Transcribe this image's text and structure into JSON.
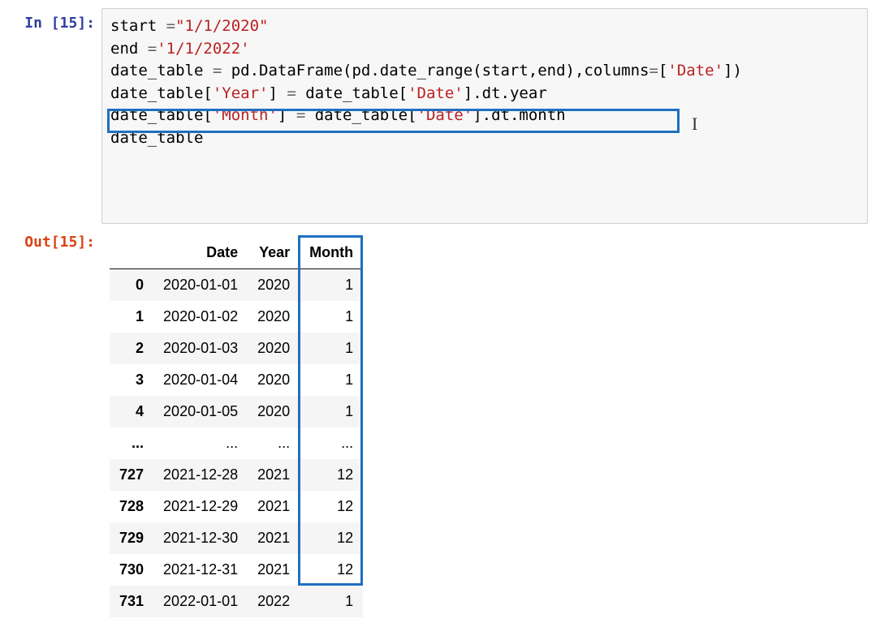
{
  "input": {
    "prompt_prefix": "In [",
    "prompt_suffix": "]:",
    "exec_count": "15",
    "code_tokens": [
      {
        "t": "start ",
        "c": ""
      },
      {
        "t": "=",
        "c": "tok-op"
      },
      {
        "t": "\"1/1/2020\"",
        "c": "tok-str"
      },
      {
        "t": "\n",
        "c": ""
      },
      {
        "t": "end ",
        "c": ""
      },
      {
        "t": "=",
        "c": "tok-op"
      },
      {
        "t": "'1/1/2022'",
        "c": "tok-str"
      },
      {
        "t": "\n",
        "c": ""
      },
      {
        "t": "date_table ",
        "c": ""
      },
      {
        "t": "=",
        "c": "tok-op"
      },
      {
        "t": " pd.DataFrame(pd.date_range(start,end),columns",
        "c": ""
      },
      {
        "t": "=",
        "c": "tok-op"
      },
      {
        "t": "[",
        "c": ""
      },
      {
        "t": "'Date'",
        "c": "tok-str"
      },
      {
        "t": "])",
        "c": ""
      },
      {
        "t": "\n",
        "c": ""
      },
      {
        "t": "date_table[",
        "c": ""
      },
      {
        "t": "'Year'",
        "c": "tok-str"
      },
      {
        "t": "] ",
        "c": ""
      },
      {
        "t": "=",
        "c": "tok-op"
      },
      {
        "t": " date_table[",
        "c": ""
      },
      {
        "t": "'Date'",
        "c": "tok-str"
      },
      {
        "t": "].dt.year",
        "c": ""
      },
      {
        "t": "\n",
        "c": ""
      },
      {
        "t": "date_table[",
        "c": ""
      },
      {
        "t": "'Month'",
        "c": "tok-str"
      },
      {
        "t": "] ",
        "c": ""
      },
      {
        "t": "=",
        "c": "tok-op"
      },
      {
        "t": " date_table[",
        "c": ""
      },
      {
        "t": "'Date'",
        "c": "tok-str"
      },
      {
        "t": "].dt.month",
        "c": ""
      },
      {
        "t": "\n",
        "c": ""
      },
      {
        "t": "date_table",
        "c": ""
      }
    ],
    "cursor_glyph": "I"
  },
  "output": {
    "prompt_prefix": "Out[",
    "prompt_suffix": "]:",
    "exec_count": "15",
    "columns": [
      "",
      "Date",
      "Year",
      "Month"
    ],
    "rows": [
      {
        "idx": "0",
        "date": "2020-01-01",
        "year": "2020",
        "month": "1"
      },
      {
        "idx": "1",
        "date": "2020-01-02",
        "year": "2020",
        "month": "1"
      },
      {
        "idx": "2",
        "date": "2020-01-03",
        "year": "2020",
        "month": "1"
      },
      {
        "idx": "3",
        "date": "2020-01-04",
        "year": "2020",
        "month": "1"
      },
      {
        "idx": "4",
        "date": "2020-01-05",
        "year": "2020",
        "month": "1"
      },
      {
        "idx": "...",
        "date": "...",
        "year": "...",
        "month": "..."
      },
      {
        "idx": "727",
        "date": "2021-12-28",
        "year": "2021",
        "month": "12"
      },
      {
        "idx": "728",
        "date": "2021-12-29",
        "year": "2021",
        "month": "12"
      },
      {
        "idx": "729",
        "date": "2021-12-30",
        "year": "2021",
        "month": "12"
      },
      {
        "idx": "730",
        "date": "2021-12-31",
        "year": "2021",
        "month": "12"
      },
      {
        "idx": "731",
        "date": "2022-01-01",
        "year": "2022",
        "month": "1"
      }
    ]
  }
}
